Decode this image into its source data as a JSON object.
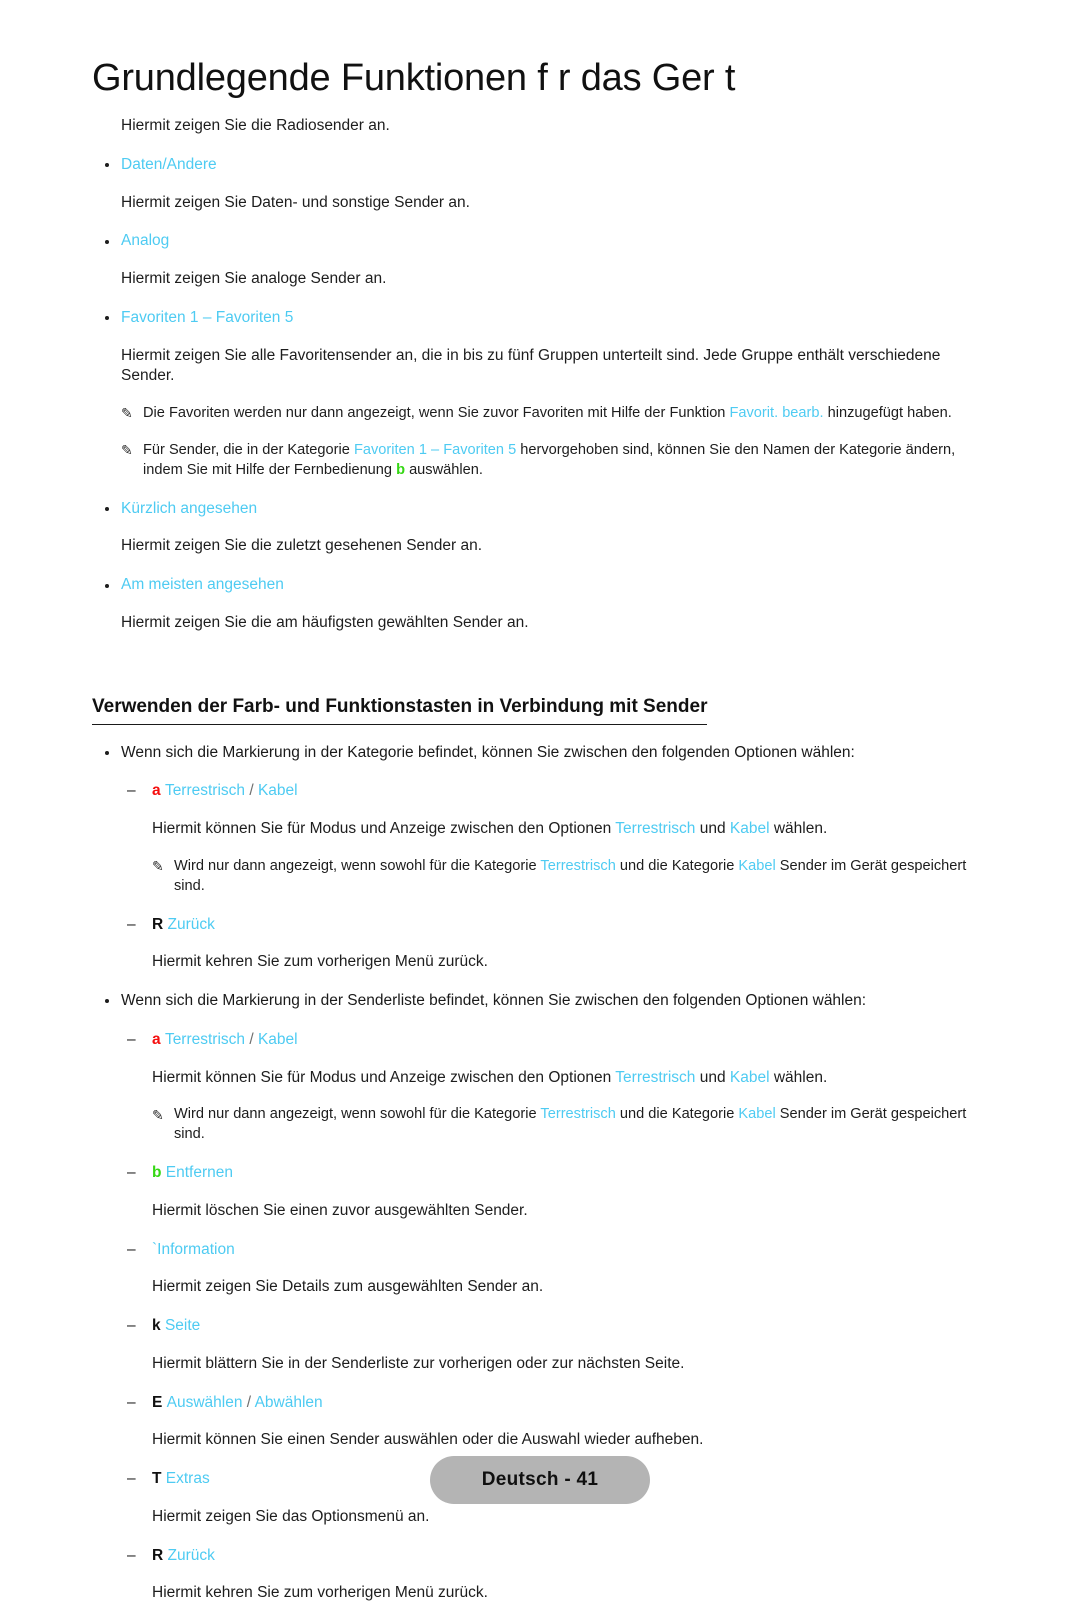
{
  "document": {
    "title": "Grundlegende Funktionen f r das Ger t",
    "language_footer": "Deutsch - 41"
  },
  "colors": {
    "accent_cyan": "#4ecbf2",
    "key_red": "#f50f0f",
    "key_green": "#35d714",
    "key_black": "#101010",
    "footer_pill": "#b4b4b4",
    "body_text": "#1d1d1d"
  },
  "icons": {
    "pencil_note": "✎",
    "bullet": "•",
    "dash": "–"
  },
  "top_section": {
    "intro_paragraph": "Hiermit zeigen Sie die Radiosender an.",
    "items": [
      {
        "label": "Daten/Andere",
        "description": "Hiermit zeigen Sie Daten- und sonstige Sender an."
      },
      {
        "label": "Analog",
        "description": "Hiermit zeigen Sie analoge Sender an."
      },
      {
        "label_parts": [
          "Favoriten 1",
          " – ",
          "Favoriten 5"
        ],
        "description": "Hiermit zeigen Sie alle Favoritensender an, die in bis zu fünf Gruppen unterteilt sind. Jede Gruppe enthält verschiedene Sender."
      },
      {
        "label": "Kürzlich angesehen",
        "description": "Hiermit zeigen Sie die zuletzt gesehenen Sender an."
      },
      {
        "label": "Am meisten angesehen",
        "description": "Hiermit zeigen Sie die am häufigsten gewählten Sender an."
      }
    ],
    "notes": [
      {
        "prefix": "Die Favoriten werden nur dann angezeigt, wenn Sie zuvor Favoriten mit Hilfe der Funktion ",
        "accent": "Favorit. bearb.",
        "suffix": " hinzugefügt haben."
      },
      {
        "p1": "Für Sender, die in der Kategorie ",
        "a1": "Favoriten 1",
        "p2": " – ",
        "a2": "Favoriten 5",
        "p3": " hervorgehoben sind, können Sie den Namen der Kategorie ändern, indem Sie mit Hilfe der Fernbedienung ",
        "key": "b",
        "p4": " auswählen."
      }
    ]
  },
  "color_buttons_section": {
    "heading": "Verwenden der Farb- und Funktionstasten in Verbindung mit Sender",
    "groups": [
      {
        "lead": "Wenn sich die Markierung in der Kategorie befindet, können Sie zwischen den folgenden Optionen wählen:",
        "entries": [
          {
            "key": "a",
            "key_color": "red",
            "label_a": "Terrestrisch",
            "separator": " / ",
            "label_b": "Kabel",
            "description": {
              "p1": "Hiermit können Sie für Modus und Anzeige zwischen den Optionen ",
              "a1": "Terrestrisch",
              "p2": " und ",
              "a2": "Kabel",
              "p3": " wählen."
            },
            "note": {
              "p1": "Wird nur dann angezeigt, wenn sowohl für die Kategorie ",
              "a1": "Terrestrisch",
              "p2": " und die Kategorie ",
              "a2": "Kabel",
              "p3": " Sender im Gerät gespeichert sind."
            }
          },
          {
            "key": "R",
            "key_color": "black",
            "label_a": "Zurück",
            "description_plain": "Hiermit kehren Sie zum vorherigen Menü zurück."
          }
        ]
      },
      {
        "lead": "Wenn sich die Markierung in der Senderliste befindet, können Sie zwischen den folgenden Optionen wählen:",
        "entries": [
          {
            "key": "a",
            "key_color": "red",
            "label_a": "Terrestrisch",
            "separator": " / ",
            "label_b": "Kabel",
            "description": {
              "p1": "Hiermit können Sie für Modus und Anzeige zwischen den Optionen ",
              "a1": "Terrestrisch",
              "p2": " und ",
              "a2": "Kabel",
              "p3": " wählen."
            },
            "note": {
              "p1": "Wird nur dann angezeigt, wenn sowohl für die Kategorie ",
              "a1": "Terrestrisch",
              "p2": " und die Kategorie ",
              "a2": "Kabel",
              "p3": " Sender im Gerät gespeichert sind."
            }
          },
          {
            "key": "b",
            "key_color": "green",
            "label_a": "Entfernen",
            "description_plain": "Hiermit löschen Sie einen zuvor ausgewählten Sender."
          },
          {
            "key": "`",
            "key_color": "cyan",
            "label_a": "Information",
            "description_plain": "Hiermit zeigen Sie Details zum ausgewählten Sender an."
          },
          {
            "key": "k",
            "key_color": "black",
            "label_a": "Seite",
            "description_plain": "Hiermit blättern Sie in der Senderliste zur vorherigen oder zur nächsten Seite."
          },
          {
            "key": "E",
            "key_color": "black",
            "label_a": "Auswählen",
            "separator": " / ",
            "label_b": "Abwählen",
            "description_plain": "Hiermit können Sie einen Sender auswählen oder die Auswahl wieder aufheben."
          },
          {
            "key": "T",
            "key_color": "black",
            "label_a": "Extras",
            "description_plain": "Hiermit zeigen Sie das Optionsmenü an."
          },
          {
            "key": "R",
            "key_color": "black",
            "label_a": "Zurück",
            "description_plain": "Hiermit kehren Sie zum vorherigen Menü zurück."
          }
        ]
      }
    ]
  }
}
